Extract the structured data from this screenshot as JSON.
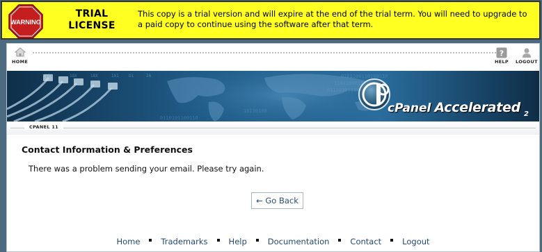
{
  "trial": {
    "warning_sign": "WARNING",
    "title_line1": "TRIAL",
    "title_line2": "LICENSE",
    "message": "This copy is a trial version and will expire at the end of the trial term. You will need to upgrade to a paid copy to continue using the software after that term."
  },
  "topnav": {
    "home": {
      "label": "HOME",
      "icon": "home-icon"
    },
    "help": {
      "label": "HELP",
      "icon": "help-icon"
    },
    "logout": {
      "label": "LOGOUT",
      "icon": "user-icon"
    }
  },
  "banner": {
    "logo_brand": "cPanel",
    "logo_product": "Accelerated",
    "logo_version": "2"
  },
  "version_label": "CPANEL 11",
  "content": {
    "title": "Contact Information & Preferences",
    "message": "There was a problem sending your email. Please try again.",
    "go_back_label": "← Go Back"
  },
  "footer": {
    "links": [
      "Home",
      "Trademarks",
      "Help",
      "Documentation",
      "Contact",
      "Logout"
    ]
  },
  "colors": {
    "trial_background": "#ffff22",
    "page_background": "#4d6b80",
    "link": "#244a73",
    "warning_red": "#c41e1e"
  }
}
